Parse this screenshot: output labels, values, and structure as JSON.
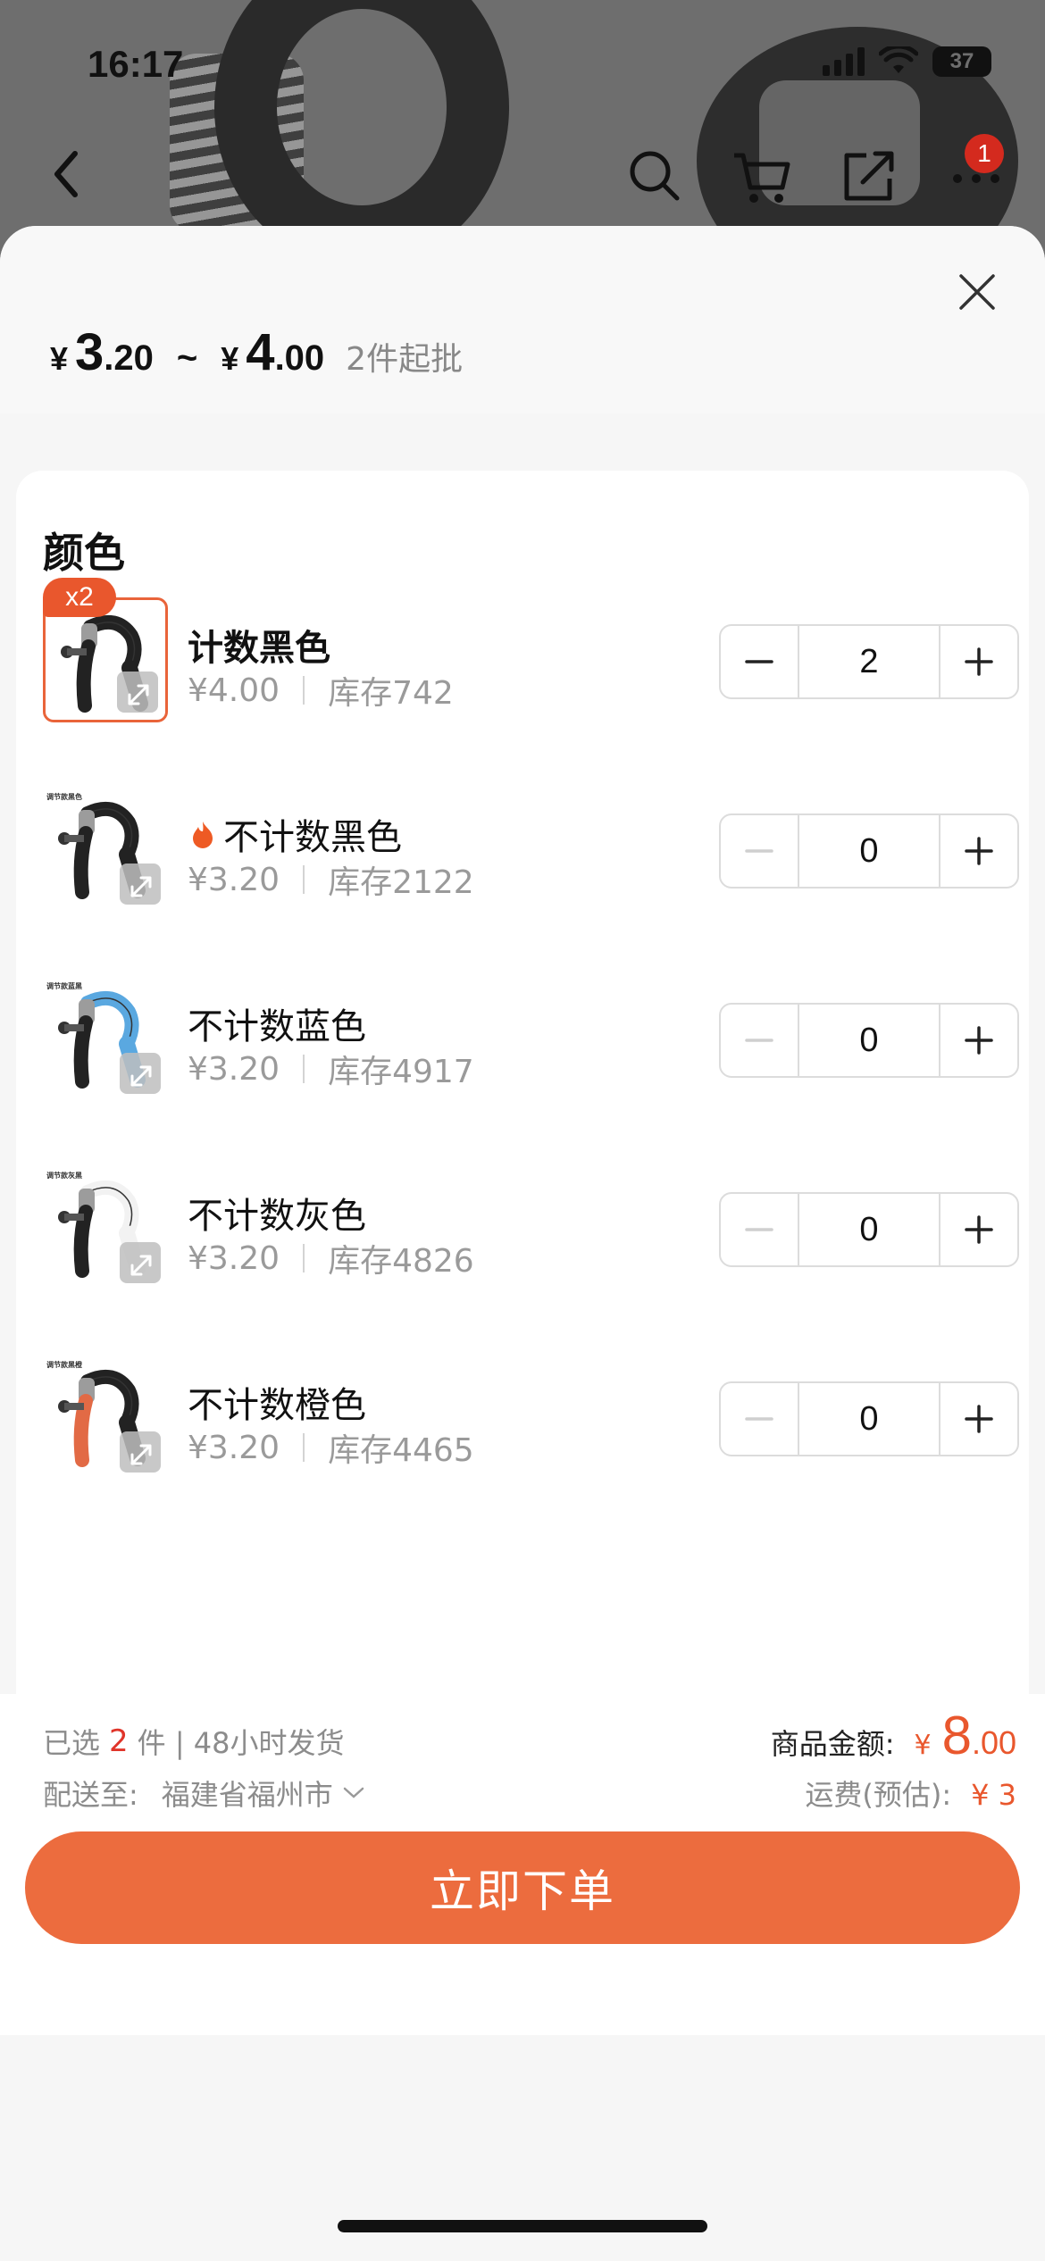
{
  "status_bar": {
    "time": "16:17",
    "battery": "37"
  },
  "nav": {
    "cart_badge": "1",
    "icons": [
      "back-icon",
      "search-icon",
      "cart-icon",
      "share-icon",
      "more-icon"
    ]
  },
  "header": {
    "currency": "¥",
    "price_min_int": "3",
    "price_min_dec": ".20",
    "separator": "~",
    "price_max_int": "4",
    "price_max_dec": ".00",
    "moq": "2件起批"
  },
  "section_title": "颜色",
  "skus": [
    {
      "name": "计数黑色",
      "price": "¥4.00",
      "stock": "库存742",
      "qty": "2",
      "badge": "x2",
      "hot": false,
      "tag": "",
      "color": "#222222",
      "accent": "#222222"
    },
    {
      "name": "不计数黑色",
      "price": "¥3.20",
      "stock": "库存2122",
      "qty": "0",
      "badge": "",
      "hot": true,
      "tag": "调节款黑色",
      "color": "#222222",
      "accent": "#222222"
    },
    {
      "name": "不计数蓝色",
      "price": "¥3.20",
      "stock": "库存4917",
      "qty": "0",
      "badge": "",
      "hot": false,
      "tag": "调节款蓝黑",
      "color": "#5aa8e0",
      "accent": "#222222"
    },
    {
      "name": "不计数灰色",
      "price": "¥3.20",
      "stock": "库存4826",
      "qty": "0",
      "badge": "",
      "hot": false,
      "tag": "调节款灰黑",
      "color": "#f2f2f2",
      "accent": "#222222"
    },
    {
      "name": "不计数橙色",
      "price": "¥3.20",
      "stock": "库存4465",
      "qty": "0",
      "badge": "",
      "hot": false,
      "tag": "调节款黑橙",
      "color": "#222222",
      "accent": "#e26a45"
    }
  ],
  "footer": {
    "selected_prefix": "已选",
    "selected_count": "2",
    "selected_suffix": "件 | 48小时发货",
    "ship_to_label": "配送至:",
    "ship_to_value": "福建省福州市",
    "amount_label": "商品金额:",
    "amount_currency": "¥",
    "amount_int": "8",
    "amount_dec": ".00",
    "freight_label": "运费(预估):",
    "freight_value": "¥ 3",
    "order_button": "立即下单"
  },
  "colors": {
    "accent": "#ec6c3e",
    "price_red": "#e9572d",
    "badge_red": "#d42a1e"
  }
}
